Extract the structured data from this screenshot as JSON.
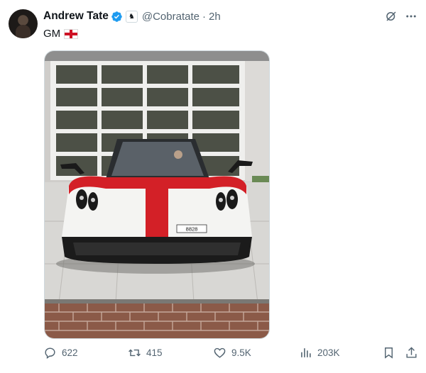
{
  "author": {
    "name": "Andrew Tate",
    "handle": "@Cobratate",
    "separator": "·",
    "time": "2h"
  },
  "post": {
    "text": "GM"
  },
  "stats": {
    "replies": "622",
    "reposts": "415",
    "likes": "9.5K",
    "views": "203K"
  },
  "icons": {
    "verified": "verified-badge-icon",
    "grok": "grok-icon",
    "more": "more-icon",
    "reply": "reply-icon",
    "repost": "repost-icon",
    "like": "heart-icon",
    "views": "views-icon",
    "bookmark": "bookmark-icon",
    "share": "share-icon"
  },
  "colors": {
    "text": "#0f1419",
    "secondary": "#536471",
    "verified": "#1d9bf0",
    "car_body": "#f4f4f2",
    "car_stripe": "#d32027"
  },
  "media": {
    "plate": "8828"
  }
}
